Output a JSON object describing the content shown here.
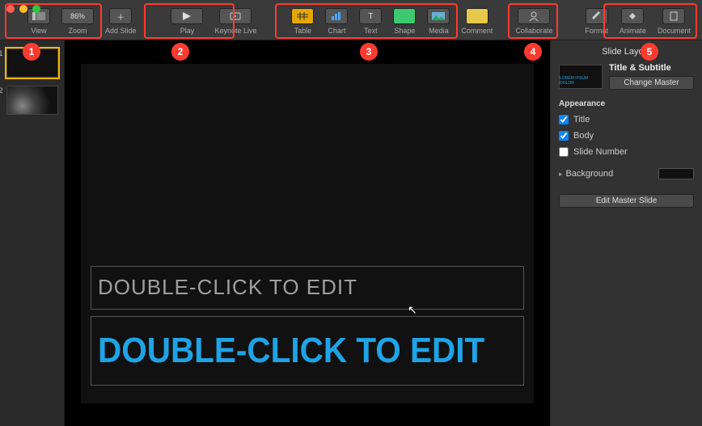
{
  "toolbar": {
    "view": "View",
    "zoom": "Zoom",
    "zoom_value": "86%",
    "add_slide": "Add Slide",
    "play": "Play",
    "keynote_live": "Keynote Live",
    "table": "Table",
    "chart": "Chart",
    "text": "Text",
    "shape": "Shape",
    "media": "Media",
    "comment": "Comment",
    "collaborate": "Collaborate",
    "format": "Format",
    "animate": "Animate",
    "document": "Document"
  },
  "annotations": {
    "n1": "1",
    "n2": "2",
    "n3": "3",
    "n4": "4",
    "n5": "5"
  },
  "thumbs": {
    "s1": "1",
    "s2": "2"
  },
  "canvas": {
    "title_placeholder": "DOUBLE-CLICK TO EDIT",
    "subtitle_placeholder": "DOUBLE-CLICK TO EDIT"
  },
  "inspector": {
    "panel_title": "Slide Layout",
    "master_thumb_text": "LOREM IPSUM DOLOR",
    "master_name": "Title & Subtitle",
    "change_master": "Change Master",
    "appearance": "Appearance",
    "chk_title": "Title",
    "chk_body": "Body",
    "chk_slide_number": "Slide Number",
    "background": "Background",
    "edit_master": "Edit Master Slide"
  }
}
